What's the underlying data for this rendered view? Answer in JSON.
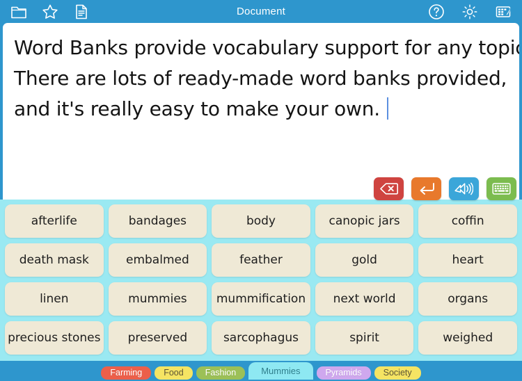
{
  "window": {
    "title": "Document",
    "accent_blue": "#2e96cd",
    "panel_cyan": "#9ae9f2",
    "card_cream": "#efe9d6"
  },
  "toolbar_left": [
    {
      "name": "folder-icon",
      "label": "Open"
    },
    {
      "name": "star-icon",
      "label": "Favourites"
    },
    {
      "name": "document-icon",
      "label": "New Document"
    }
  ],
  "toolbar_right": [
    {
      "name": "help-icon",
      "label": "Help"
    },
    {
      "name": "gear-icon",
      "label": "Settings"
    },
    {
      "name": "edit-grid-icon",
      "label": "Edit Word Bank"
    }
  ],
  "document": {
    "lines": [
      "Word Banks provide vocabulary support for any topic.",
      "There are lots of ready-made word banks provided,",
      "and it's really easy to make your own."
    ]
  },
  "actions": [
    {
      "name": "delete-button",
      "label": "Delete",
      "color": "#cf4440",
      "icon": "backspace-icon"
    },
    {
      "name": "enter-button",
      "label": "Enter",
      "color": "#e8792c",
      "icon": "enter-arrow-icon"
    },
    {
      "name": "speak-button",
      "label": "Speak",
      "color": "#3ba6d9",
      "icon": "speaker-icon"
    },
    {
      "name": "keyboard-button",
      "label": "Keyboard",
      "color": "#7cbc4f",
      "icon": "keyboard-icon"
    }
  ],
  "word_bank": {
    "rows": [
      [
        "afterlife",
        "bandages",
        "body",
        "canopic jars",
        "coffin"
      ],
      [
        "death mask",
        "embalmed",
        "feather",
        "gold",
        "heart"
      ],
      [
        "linen",
        "mummies",
        "mummification",
        "next world",
        "organs"
      ],
      [
        "precious stones",
        "preserved",
        "sarcophagus",
        "spirit",
        "weighed"
      ]
    ]
  },
  "categories": [
    {
      "label": "Farming",
      "color": "#ec5f4a",
      "selected": false,
      "dark_text": false
    },
    {
      "label": "Food",
      "color": "#f5e463",
      "selected": false,
      "dark_text": true
    },
    {
      "label": "Fashion",
      "color": "#9cc057",
      "selected": false,
      "dark_text": false
    },
    {
      "label": "Mummies",
      "color": "#8ee8f2",
      "selected": true,
      "dark_text": false
    },
    {
      "label": "Pyramids",
      "color": "#cfa8ee",
      "selected": false,
      "dark_text": false
    },
    {
      "label": "Society",
      "color": "#f5e463",
      "selected": false,
      "dark_text": true
    }
  ]
}
